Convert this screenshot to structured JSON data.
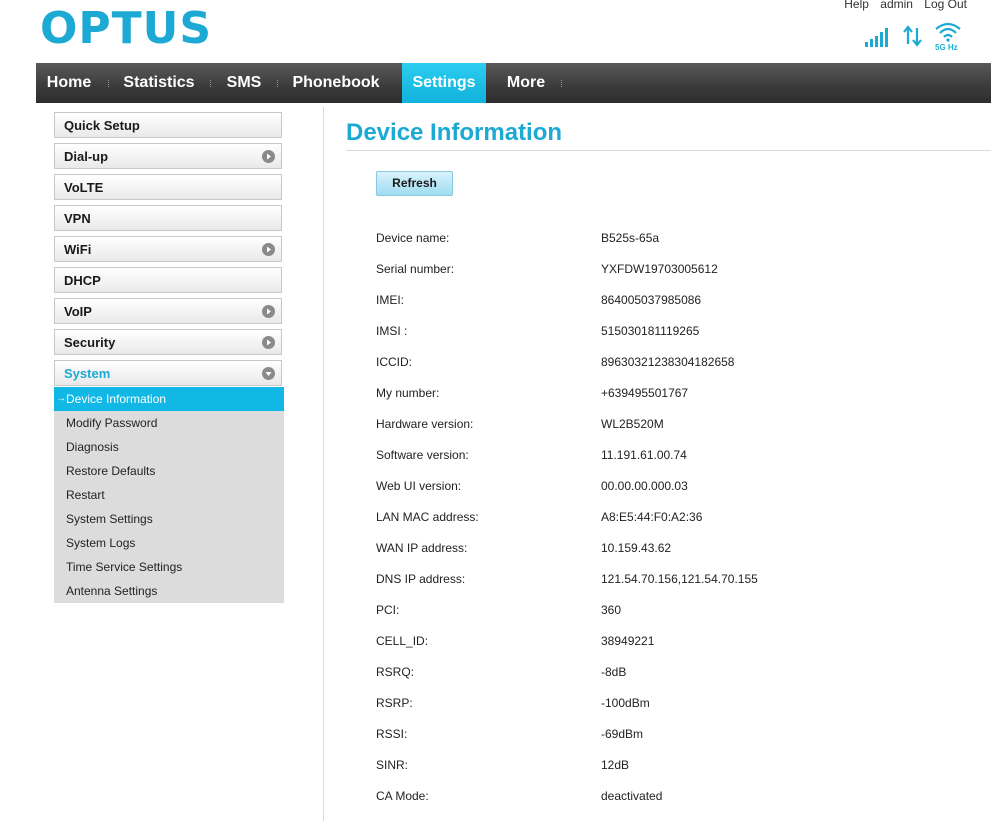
{
  "brand": {
    "logo_text": "OPTUS",
    "logo_color": "#1ca9d4"
  },
  "top_links": {
    "help": "Help",
    "user": "admin",
    "logout": "Log Out"
  },
  "status": {
    "wifi_band": "5G Hz"
  },
  "nav": {
    "items": [
      {
        "label": "Home"
      },
      {
        "label": "Statistics"
      },
      {
        "label": "SMS"
      },
      {
        "label": "Phonebook"
      },
      {
        "label": "Settings",
        "active": true
      },
      {
        "label": "More"
      }
    ]
  },
  "sidebar": {
    "items": [
      {
        "label": "Quick Setup"
      },
      {
        "label": "Dial-up"
      },
      {
        "label": "VoLTE"
      },
      {
        "label": "VPN"
      },
      {
        "label": "WiFi"
      },
      {
        "label": "DHCP"
      },
      {
        "label": "VoIP"
      },
      {
        "label": "Security"
      },
      {
        "label": "System"
      }
    ],
    "system_submenu": [
      "Device Information",
      "Modify Password",
      "Diagnosis",
      "Restore Defaults",
      "Restart",
      "System Settings",
      "System Logs",
      "Time Service Settings",
      "Antenna Settings"
    ]
  },
  "main": {
    "title": "Device Information",
    "refresh_label": "Refresh",
    "rows": [
      {
        "label": "Device name:",
        "value": "B525s-65a"
      },
      {
        "label": "Serial number:",
        "value": "YXFDW19703005612"
      },
      {
        "label": "IMEI:",
        "value": "864005037985086"
      },
      {
        "label": "IMSI :",
        "value": "515030181119265"
      },
      {
        "label": "ICCID:",
        "value": "89630321238304182658"
      },
      {
        "label": "My number:",
        "value": "+639495501767"
      },
      {
        "label": "Hardware version:",
        "value": "WL2B520M"
      },
      {
        "label": "Software version:",
        "value": "11.191.61.00.74"
      },
      {
        "label": "Web UI version:",
        "value": "00.00.00.000.03"
      },
      {
        "label": "LAN MAC address:",
        "value": "A8:E5:44:F0:A2:36"
      },
      {
        "label": "WAN IP address:",
        "value": "10.159.43.62"
      },
      {
        "label": "DNS IP address:",
        "value": "121.54.70.156,121.54.70.155"
      },
      {
        "label": "PCI:",
        "value": "360"
      },
      {
        "label": "CELL_ID:",
        "value": "38949221"
      },
      {
        "label": "RSRQ:",
        "value": "-8dB"
      },
      {
        "label": "RSRP:",
        "value": "-100dBm"
      },
      {
        "label": "RSSI:",
        "value": "-69dBm"
      },
      {
        "label": "SINR:",
        "value": "12dB"
      },
      {
        "label": "CA Mode:",
        "value": "deactivated"
      }
    ]
  },
  "colors": {
    "accent": "#1ca9d4",
    "nav_active": "#11b8e6",
    "nav_bg": "#3a3a3a"
  }
}
